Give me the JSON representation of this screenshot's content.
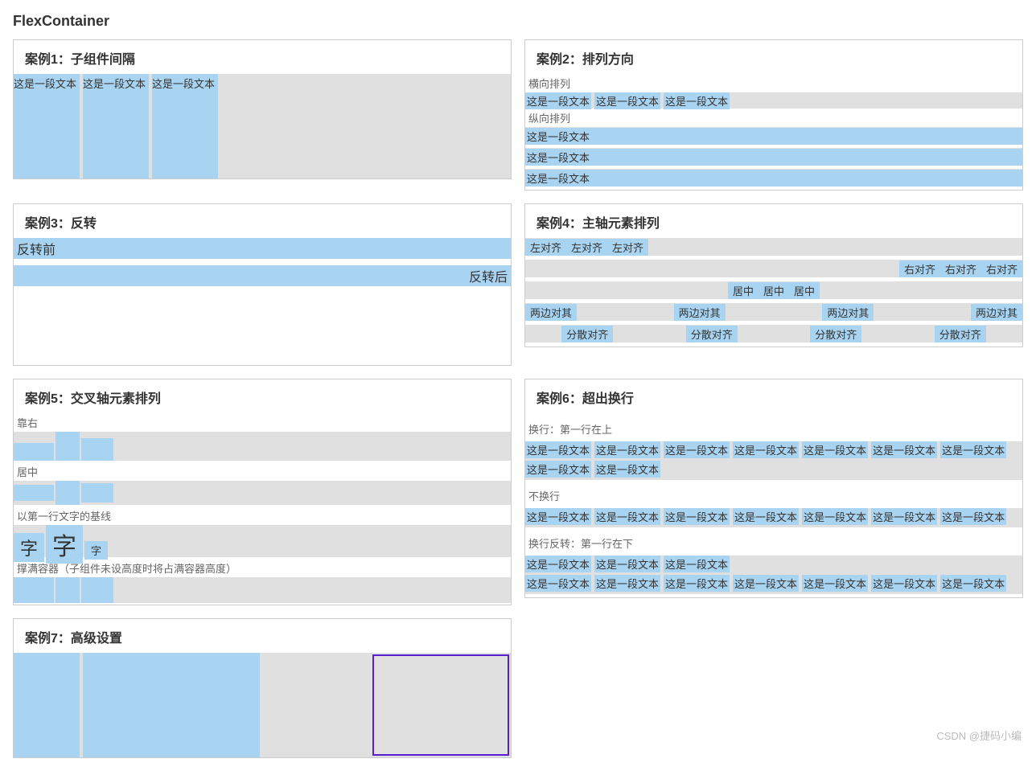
{
  "page_title": "FlexContainer",
  "watermark": "CSDN @捷码小编",
  "sample_text": "这是一段文本",
  "case1": {
    "title": "案例1：子组件间隔"
  },
  "case2": {
    "title": "案例2：排列方向",
    "h_label": "横向排列",
    "v_label": "纵向排列"
  },
  "case3": {
    "title": "案例3：反转",
    "before": "反转前",
    "after": "反转后"
  },
  "case4": {
    "title": "案例4：主轴元素排列",
    "left": "左对齐",
    "right": "右对齐",
    "center": "居中",
    "between": "两边对其",
    "around": "分散对齐"
  },
  "case5": {
    "title": "案例5：交叉轴元素排列",
    "row1": "靠右",
    "row2": "居中",
    "row3": "以第一行文字的基线",
    "row4": "撑满容器（子组件未设高度时将占满容器高度）",
    "char": "字"
  },
  "case6": {
    "title": "案例6：超出换行",
    "wrap_top": "换行：第一行在上",
    "nowrap": "不换行",
    "wrap_reverse": "换行反转：第一行在下"
  },
  "case7": {
    "title": "案例7：高级设置"
  }
}
